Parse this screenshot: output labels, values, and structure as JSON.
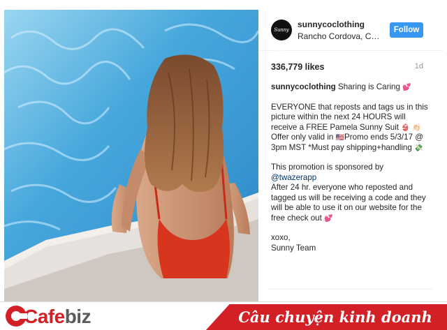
{
  "post": {
    "username": "sunnycoclothing",
    "location": "Rancho Cordova, California",
    "avatar_text": "Sunny Co",
    "follow_label": "Follow",
    "likes": "336,779 likes",
    "age": "1d",
    "caption": {
      "author": "sunnycoclothing",
      "lead": "Sharing is Caring",
      "p1_a": "EVERYONE that reposts and tags us in this picture within the next 24 HOURS will receive a FREE Pamela Sunny Suit",
      "p1_b": "Offer only valid in",
      "p1_c": "Promo ends 5/3/17 @ 3pm MST *Must pay shipping+handling",
      "p2_a": "This promotion is sponsored by",
      "p2_mention": "@twazerapp",
      "p2_b": "After 24 hr. everyone who reposted and tagged us will be receiving a code and they will be able to use it on our website for the free check out",
      "sign1": "xoxo,",
      "sign2": "Sunny Team"
    },
    "emoji": {
      "heart": "💕",
      "bikini": "👙",
      "hand": "👏🏻",
      "flag": "🇺🇸",
      "money": "💸"
    },
    "colors": {
      "follow": "#3897f0",
      "mention": "#003569"
    }
  },
  "banner": {
    "brand_part1": "Cafe",
    "brand_part2": "biz",
    "tagline": "Câu chuyện kinh doanh",
    "colors": {
      "brand_red": "#d32027",
      "brand_grey": "#5b5b5b"
    }
  }
}
